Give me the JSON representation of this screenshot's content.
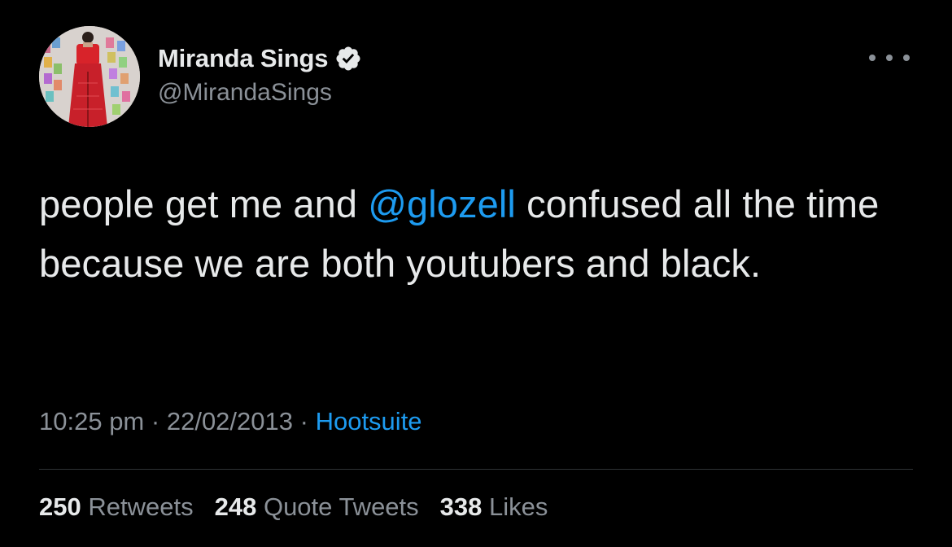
{
  "author": {
    "display_name": "Miranda Sings",
    "handle": "@MirandaSings",
    "verified": true,
    "verified_icon": "verified-badge-icon"
  },
  "more_icon": "more-horizontal-icon",
  "tweet": {
    "text_before": "people get me and ",
    "mention": "@glozell",
    "text_after": " confused all the time because we are both youtubers and black."
  },
  "meta": {
    "time": "10:25 pm",
    "separator": "·",
    "date": "22/02/2013",
    "source": "Hootsuite"
  },
  "stats": [
    {
      "count": "250",
      "label": "Retweets"
    },
    {
      "count": "248",
      "label": "Quote Tweets"
    },
    {
      "count": "338",
      "label": "Likes"
    }
  ],
  "colors": {
    "background": "#000000",
    "text": "#e7e9ea",
    "secondary": "#8b9198",
    "accent": "#1d9bf0",
    "divider": "#2f3336"
  }
}
